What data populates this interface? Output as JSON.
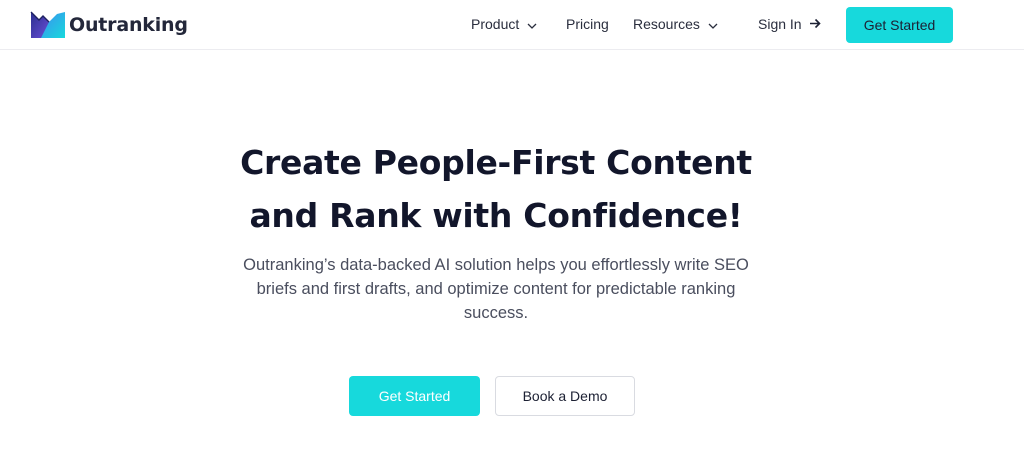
{
  "brand": {
    "name": "Outranking",
    "accent_color": "#17d9dc",
    "logo_icon": "outranking-logo-icon"
  },
  "nav": {
    "items": [
      {
        "label": "Product",
        "icon": "chevron-down-icon"
      },
      {
        "label": "Pricing"
      },
      {
        "label": "Resources",
        "icon": "chevron-down-icon"
      }
    ],
    "sign_in": {
      "label": "Sign In",
      "icon": "arrow-right-icon"
    },
    "cta_label": "Get Started"
  },
  "hero": {
    "title_line1": "Create People-First Content",
    "title_line2": "and Rank with Confidence!",
    "subtitle": "Outranking’s data-backed AI solution helps you effortlessly write SEO briefs and first drafts, and optimize content for predictable ranking success.",
    "primary_cta": "Get Started",
    "secondary_cta": "Book a Demo"
  }
}
